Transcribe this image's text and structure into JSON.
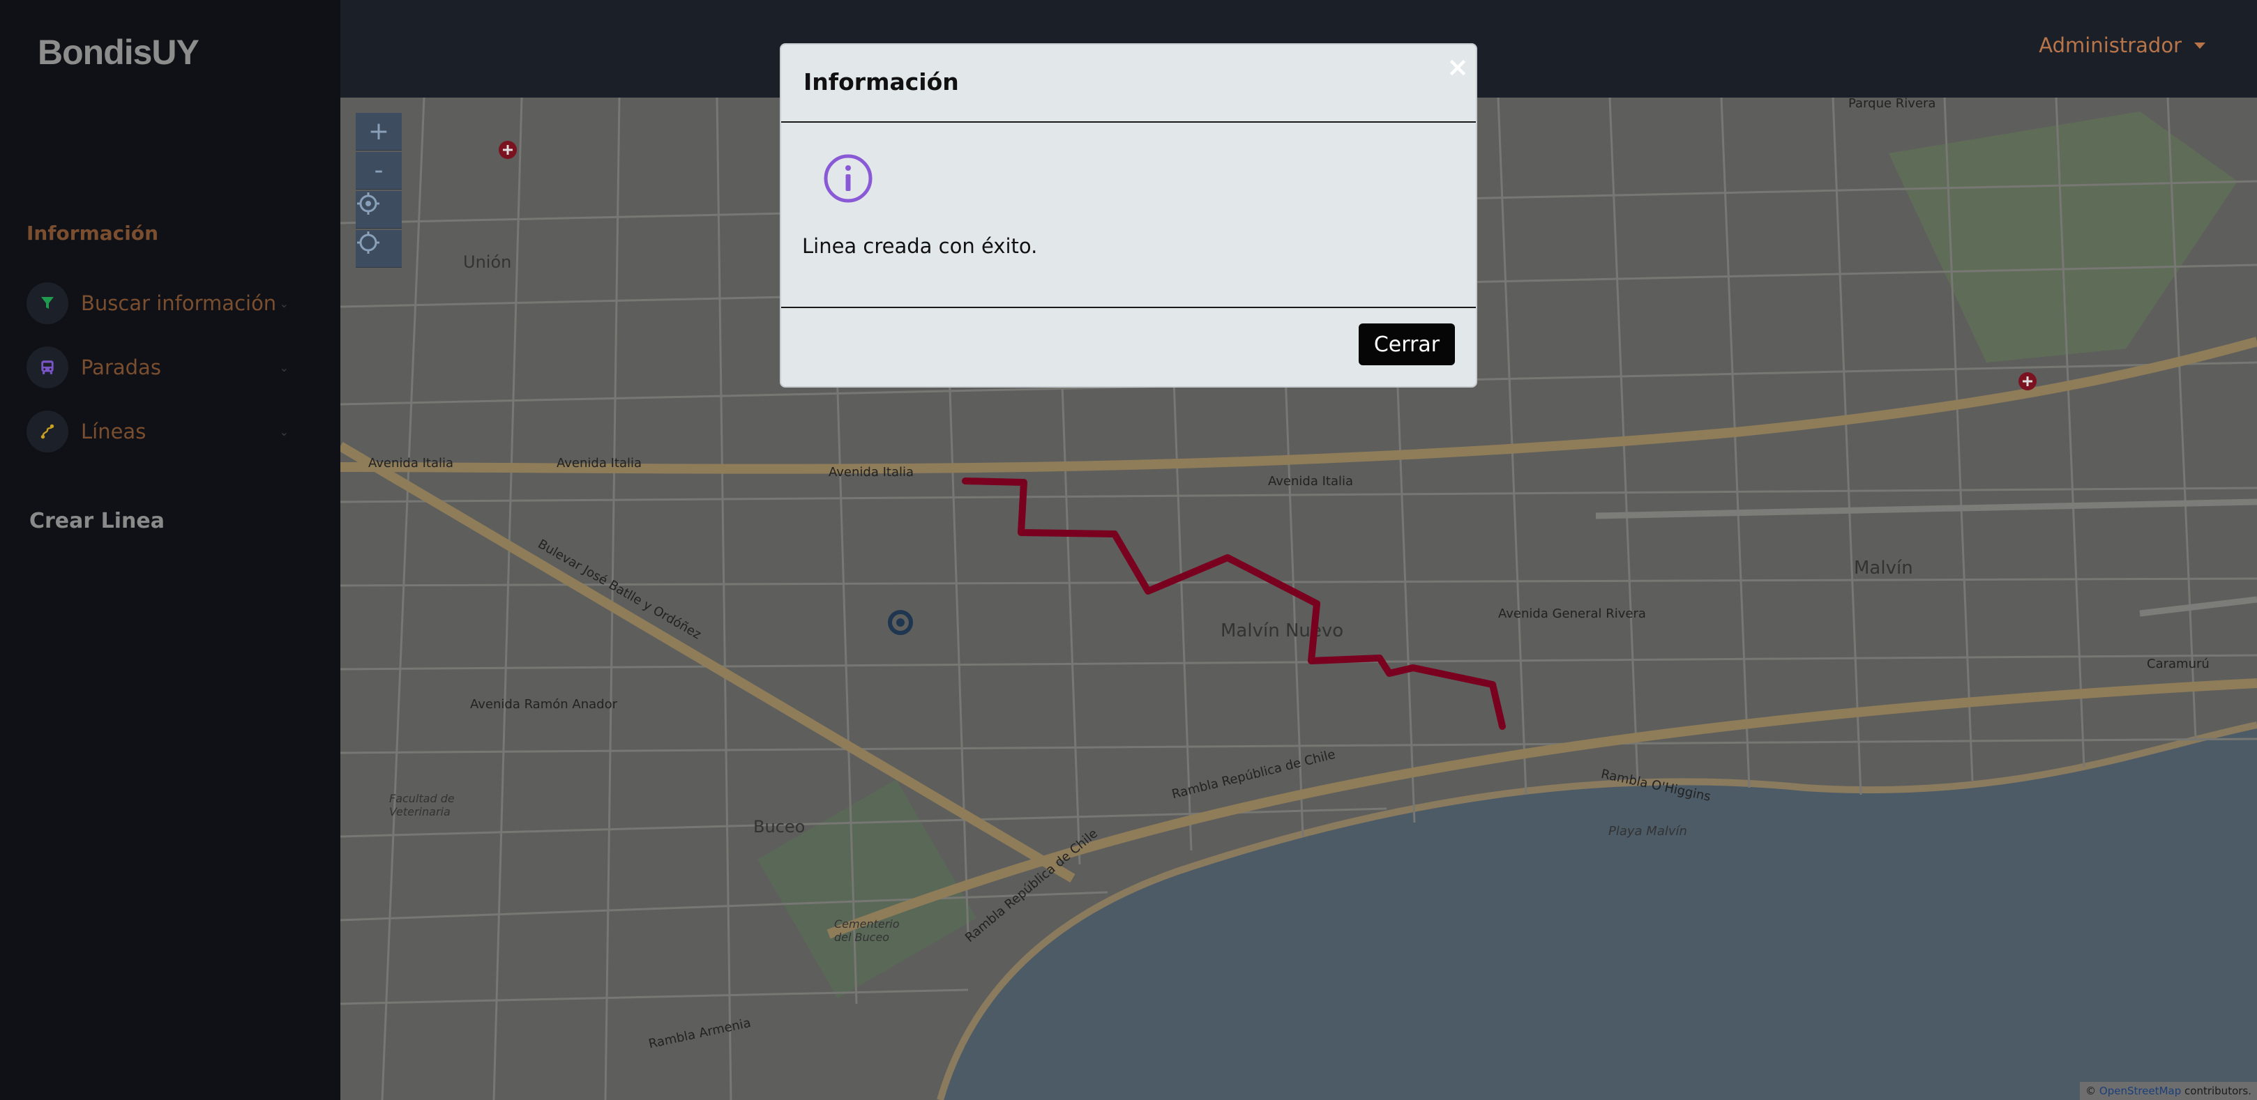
{
  "app": {
    "brand": "BondisUY"
  },
  "sidebar": {
    "section_title": "Información",
    "items": [
      {
        "label": "Buscar información",
        "icon": "filter-icon",
        "icon_color": "#1e9b4f"
      },
      {
        "label": "Paradas",
        "icon": "bus-icon",
        "icon_color": "#7a55c8"
      },
      {
        "label": "Líneas",
        "icon": "route-icon",
        "icon_color": "#c9a022"
      }
    ],
    "crear_linea": "Crear Linea"
  },
  "topbar": {
    "user_label": "Administrador"
  },
  "map": {
    "controls": [
      "+",
      "-"
    ],
    "street_labels": [
      "Avenida Italia",
      "Avenida Italia",
      "Avenida Italia",
      "Avenida Italia",
      "Bulevar José Batlle y Ordóñez",
      "Malvín Nuevo",
      "Malvín",
      "Avenida General Rivera",
      "Rambla República de Chile",
      "Rambla O'Higgins",
      "Unión",
      "Buceo",
      "Parque Rivera",
      "Caramurú",
      "Avenida Ramón Anador",
      "Facultad de Veterinaria",
      "Cementerio del Buceo",
      "Rambla Armenia",
      "Rambla República de Chile",
      "Playa Malvín"
    ],
    "attribution_prefix": "©",
    "attribution_link": "OpenStreetMap",
    "attribution_suffix": "contributors.",
    "route_color": "#7a0020"
  },
  "modal": {
    "title": "Información",
    "close": "×",
    "message": "Linea creada con éxito.",
    "button_label": "Cerrar",
    "icon": "info-icon",
    "icon_color": "#8a5ad6"
  }
}
